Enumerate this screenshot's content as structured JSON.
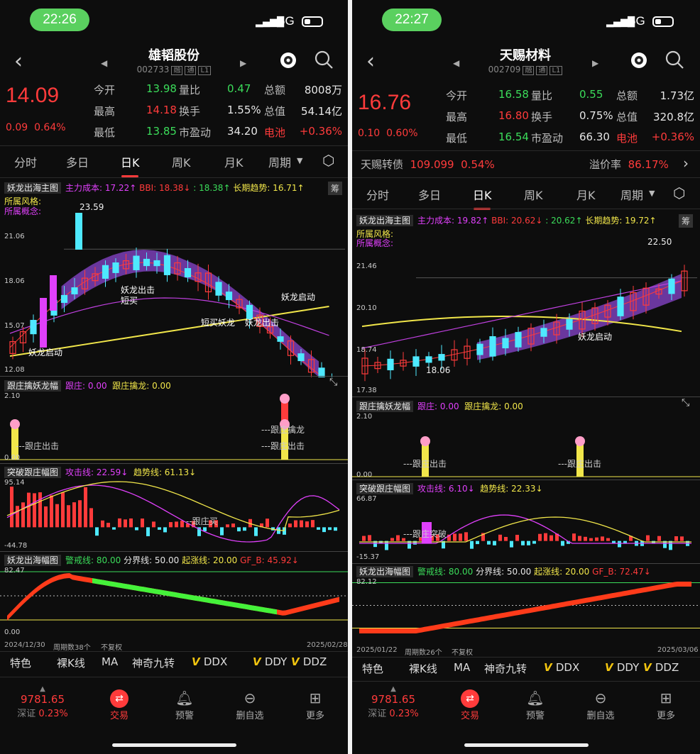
{
  "left": {
    "status": {
      "time": "22:26",
      "network": "5G"
    },
    "nav": {
      "title": "雄韬股份",
      "code": "002733",
      "tag1": "融",
      "tag2": "通",
      "tag3": "L1"
    },
    "quote": {
      "price": "14.09",
      "change": "0.09",
      "change_pct": "0.64%",
      "rows": [
        {
          "l1": "今开",
          "v1": "13.98",
          "l2": "量比",
          "v2": "0.47",
          "l3": "总额",
          "v3": "8008万"
        },
        {
          "l1": "最高",
          "v1": "14.18",
          "l2": "换手",
          "v2": "1.55%",
          "l3": "总值",
          "v3": "54.14亿"
        },
        {
          "l1": "最低",
          "v1": "13.85",
          "l2": "市盈动",
          "v2": "34.20",
          "l3": "电池",
          "v3": "+0.36%"
        }
      ]
    },
    "tabs": [
      "分时",
      "多日",
      "日K",
      "周K",
      "月K",
      "周期"
    ],
    "main_indicator": {
      "name": "妖龙出海主图",
      "cost": "主力成本: 17.22↑",
      "bbi": "BBI: 18.38↓",
      "bbi2": ": 18.38↑",
      "trend": "长期趋势: 16.71↑",
      "style": "所属风格:",
      "concept": "所属概念:",
      "btn": "筹"
    },
    "main_axis": [
      "21.06",
      "18.06",
      "15.07",
      "12.08"
    ],
    "main_labels": {
      "high": "23.59",
      "l1": "妖龙启动",
      "l2": "妖龙出击",
      "l3": "短买",
      "l4": "妖龙启动",
      "l5": "短买妖龙",
      "l6": "妖龙出击"
    },
    "ind2": {
      "name": "跟庄擒妖龙幅",
      "a": "跟庄: 0.00",
      "b": "跟庄擒龙: 0.00",
      "axis": [
        "2.10",
        "0.00"
      ],
      "lbl1": "---跟庄出击",
      "lbl2": "---跟庄擒龙",
      "lbl3": "---跟庄出击"
    },
    "ind3": {
      "name": "突破跟庄幅图",
      "a": "攻击线: 22.59↓",
      "b": "趋势线: 61.13↓",
      "axis": [
        "95.14",
        "-44.78"
      ],
      "lbl": "--跟庄买"
    },
    "ind4": {
      "name": "妖龙出海幅图",
      "a": "警戒线: 80.00",
      "b": "分界线: 50.00",
      "c": "起涨线: 20.00",
      "d": "GF_B: 45.92↓",
      "axis": [
        "82.47",
        "0.00"
      ]
    },
    "footer": {
      "start": "2024/12/30",
      "count": "周期数38个",
      "adj": "不复权",
      "end": "2025/02/28"
    },
    "bottom_tabs": [
      "特色",
      "裸K线",
      "MA",
      "神奇九转",
      "DDX",
      "DDY",
      "DDZ"
    ],
    "bottom_nav": {
      "index_val": "9781.65",
      "index_name": "深证",
      "index_pct": "0.23%",
      "trade": "交易",
      "alert": "预警",
      "delete": "删自选",
      "more": "更多"
    }
  },
  "right": {
    "status": {
      "time": "22:27",
      "network": "5G"
    },
    "nav": {
      "title": "天赐材料",
      "code": "002709",
      "tag1": "融",
      "tag2": "通",
      "tag3": "L1"
    },
    "quote": {
      "price": "16.76",
      "change": "0.10",
      "change_pct": "0.60%",
      "rows": [
        {
          "l1": "今开",
          "v1": "16.58",
          "l2": "量比",
          "v2": "0.55",
          "l3": "总额",
          "v3": "1.73亿"
        },
        {
          "l1": "最高",
          "v1": "16.80",
          "l2": "换手",
          "v2": "0.75%",
          "l3": "总值",
          "v3": "320.8亿"
        },
        {
          "l1": "最低",
          "v1": "16.54",
          "l2": "市盈动",
          "v2": "66.30",
          "l3": "电池",
          "v3": "+0.36%"
        }
      ]
    },
    "convertible": {
      "name": "天赐转债",
      "price": "109.099",
      "pct": "0.54%",
      "prem_label": "溢价率",
      "prem": "86.17%"
    },
    "tabs": [
      "分时",
      "多日",
      "日K",
      "周K",
      "月K",
      "周期"
    ],
    "main_indicator": {
      "name": "妖龙出海主图",
      "cost": "主力成本: 19.82↑",
      "bbi": "BBI: 20.62↓",
      "bbi2": ": 20.62↑",
      "trend": "长期趋势: 19.72↑",
      "style": "所属风格:",
      "concept": "所属概念:",
      "btn": "筹"
    },
    "main_axis": [
      "21.46",
      "20.10",
      "18.74",
      "17.38"
    ],
    "main_labels": {
      "high": "22.50",
      "low": "18.06",
      "l1": "妖龙启动"
    },
    "ind2": {
      "name": "跟庄擒妖龙幅",
      "a": "跟庄: 0.00",
      "b": "跟庄擒龙: 0.00",
      "axis": [
        "2.10",
        "0.00"
      ],
      "lbl1": "---跟庄出击",
      "lbl2": "---跟庄出击"
    },
    "ind3": {
      "name": "突破跟庄幅图",
      "a": "攻击线: 6.10↓",
      "b": "趋势线: 22.33↓",
      "axis": [
        "66.87",
        "-15.37"
      ],
      "lbl": "---跟庄突破"
    },
    "ind4": {
      "name": "妖龙出海幅图",
      "a": "警戒线: 80.00",
      "b": "分界线: 50.00",
      "c": "起涨线: 20.00",
      "d": "GF_B: 72.47↓",
      "axis": [
        "82.12"
      ]
    },
    "footer": {
      "start": "2025/01/22",
      "count": "周期数26个",
      "adj": "不复权",
      "end": "2025/03/06"
    },
    "bottom_tabs": [
      "特色",
      "裸K线",
      "MA",
      "神奇九转",
      "DDX",
      "DDY",
      "DDZ"
    ],
    "bottom_nav": {
      "index_val": "9781.65",
      "index_name": "深证",
      "index_pct": "0.23%",
      "trade": "交易",
      "alert": "预警",
      "delete": "删自选",
      "more": "更多"
    }
  },
  "colors": {
    "up": "#ff3b3b",
    "down": "#3bdc5a",
    "accent": "#5ad05f",
    "yellow": "#f1e64a",
    "magenta": "#e040fb",
    "cyan": "#4ee9ff"
  }
}
